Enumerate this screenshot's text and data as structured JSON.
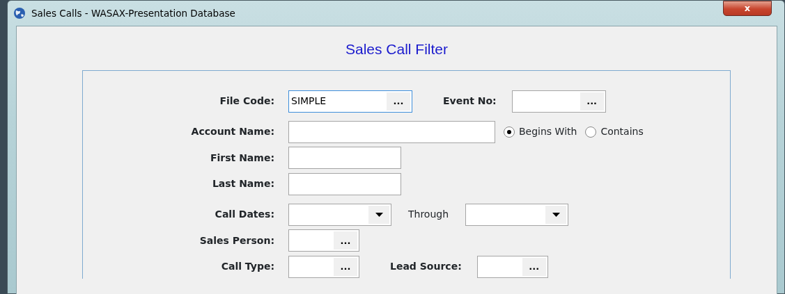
{
  "window": {
    "title": "Sales Calls - WASAX-Presentation Database",
    "close_button": "x"
  },
  "heading": "Sales Call Filter",
  "rows": [
    {
      "fields": [
        {
          "label": "File Code:",
          "kind": "lookup",
          "value": "SIMPLE",
          "focused": true,
          "button": "..."
        },
        {
          "label": "Event No:",
          "kind": "lookup",
          "focused": false,
          "button": "..."
        }
      ]
    },
    {
      "fields": [
        {
          "label": "Account Name:",
          "kind": "text",
          "focused": false
        }
      ],
      "options": [
        {
          "label": "Begins With",
          "selected": true
        },
        {
          "label": "Contains",
          "selected": false
        }
      ]
    },
    {
      "fields": [
        {
          "label": "First Name:",
          "kind": "text",
          "focused": false
        }
      ]
    },
    {
      "fields": [
        {
          "label": "Last Name:",
          "kind": "text",
          "focused": false
        }
      ]
    },
    {
      "fields": [
        {
          "label": "Call Dates:",
          "kind": "dropdown",
          "focused": false
        },
        {
          "label": "Through",
          "kind": "dropdown",
          "focused": false
        }
      ]
    },
    {
      "fields": [
        {
          "label": "Sales Person:",
          "kind": "lookup",
          "focused": false,
          "button": "..."
        }
      ]
    },
    {
      "fields": [
        {
          "label": "Call Type:",
          "kind": "lookup",
          "focused": false,
          "button": "..."
        },
        {
          "label": "Lead Source:",
          "kind": "lookup",
          "focused": false,
          "button": "..."
        }
      ]
    }
  ]
}
